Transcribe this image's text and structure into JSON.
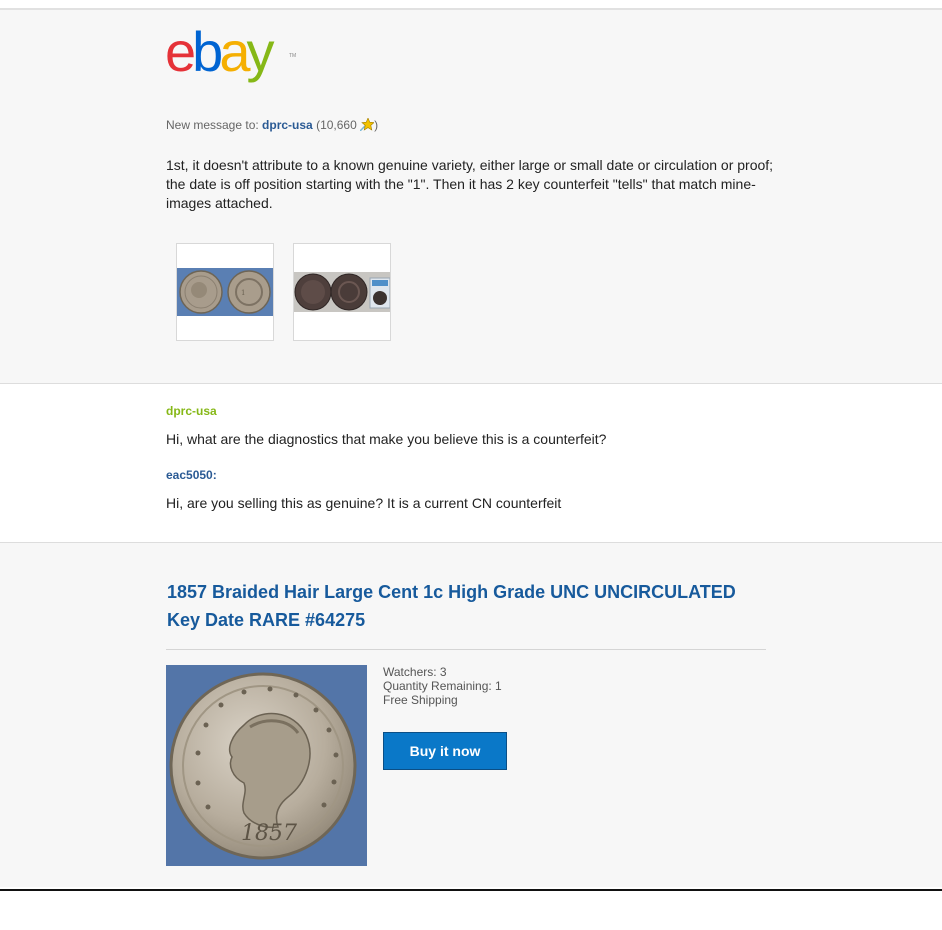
{
  "logo": {
    "letters": [
      "e",
      "b",
      "a",
      "y"
    ],
    "trademark": "TM",
    "colors": {
      "e": "#e53238",
      "b": "#0064d2",
      "a": "#f5af02",
      "y": "#86b817"
    }
  },
  "message": {
    "prefix": "New message to: ",
    "recipient": "dprc-usa",
    "feedback_open": " (10,660",
    "feedback_close": ")",
    "star_icon": "shooting-star-icon",
    "body": "1st, it doesn't attribute to a known genuine variety, either large or small date or circulation or proof; the date is off position starting with the \"1\". Then it has 2 key counterfeit \"tells\" that match mine- images attached.",
    "attachments": [
      "coin-photo-icon",
      "coin-photo-icon"
    ]
  },
  "conversation": {
    "messages": [
      {
        "sender": "dprc-usa",
        "text": "Hi, what are the diagnostics that make you believe this is a counterfeit?"
      },
      {
        "sender": "eac5050:",
        "text": "Hi, are you selling this as genuine? It is a current CN counterfeit"
      }
    ]
  },
  "item": {
    "title": "1857 Braided Hair Large Cent 1c High Grade UNC UNCIRCULATED Key Date RARE #64275",
    "watchers": "Watchers: 3",
    "quantity": "Quantity Remaining: 1",
    "shipping": "Free Shipping",
    "buy_label": "Buy it now",
    "coin_date": "1857",
    "accent": "#0a78c8"
  }
}
